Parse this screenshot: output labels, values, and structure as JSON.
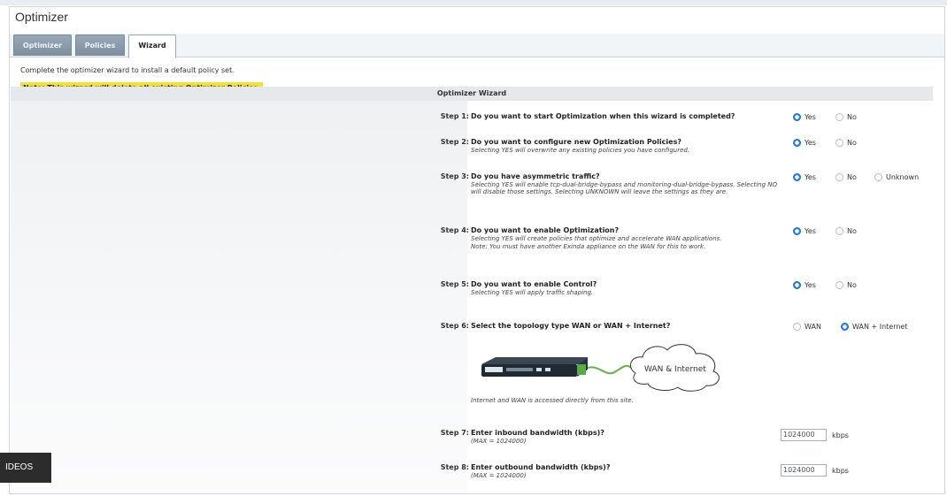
{
  "page": {
    "title": "Optimizer"
  },
  "tabs": [
    {
      "label": "Optimizer",
      "active": false
    },
    {
      "label": "Policies",
      "active": false
    },
    {
      "label": "Wizard",
      "active": true
    }
  ],
  "intro": "Complete the optimizer wizard to install a default policy set.",
  "note": "Note: This wizard will delete all existing Optimizer Policies.",
  "wizard_title": "Optimizer Wizard",
  "steps": [
    {
      "label": "Step 1:",
      "question": "Do you want to start Optimization when this wizard is completed?",
      "desc": "",
      "options": [
        "Yes",
        "No"
      ],
      "selected": "Yes"
    },
    {
      "label": "Step 2:",
      "question": "Do you want to configure new Optimization Policies?",
      "desc": "Selecting YES will overwrite any existing policies you have configured.",
      "options": [
        "Yes",
        "No"
      ],
      "selected": "Yes"
    },
    {
      "label": "Step 3:",
      "question": "Do you have asymmetric traffic?",
      "desc": "Selecting YES will enable tcp-dual-bridge-bypass and monitoring-dual-bridge-bypass. Selecting NO will disable those settings. Selecting UNKNOWN will leave the settings as they are.",
      "options": [
        "Yes",
        "No",
        "Unknown"
      ],
      "selected": "Yes"
    },
    {
      "label": "Step 4:",
      "question": "Do you want to enable Optimization?",
      "desc": "Selecting YES will create policies that optimize and accelerate WAN applications.",
      "desc2": "Note: You must have another Exinda appliance on the WAN for this to work.",
      "options": [
        "Yes",
        "No"
      ],
      "selected": "Yes"
    },
    {
      "label": "Step 5:",
      "question": "Do you want to enable Control?",
      "desc": "Selecting YES will apply traffic shaping.",
      "options": [
        "Yes",
        "No"
      ],
      "selected": "Yes"
    },
    {
      "label": "Step 6:",
      "question": "Select the topology type WAN or WAN + Internet?",
      "desc": "",
      "options": [
        "WAN",
        "WAN + Internet"
      ],
      "selected": "WAN + Internet"
    },
    {
      "label": "Step 7:",
      "question": "Enter inbound bandwidth (kbps)?",
      "desc": "(MAX = 1024000)",
      "value": "1024000",
      "unit": "kbps"
    },
    {
      "label": "Step 8:",
      "question": "Enter outbound bandwidth (kbps)?",
      "desc": "(MAX = 1024000)",
      "value": "1024000",
      "unit": "kbps"
    }
  ],
  "topology": {
    "cloud_label": "WAN & Internet",
    "caption": "Internet and WAN is accessed directly from this site."
  },
  "overlay": {
    "label": "IDEOS"
  },
  "colors": {
    "selected_radio": "#2f84db",
    "note_highlight": "#f2e040",
    "tab_inactive": "#8a99a9"
  }
}
